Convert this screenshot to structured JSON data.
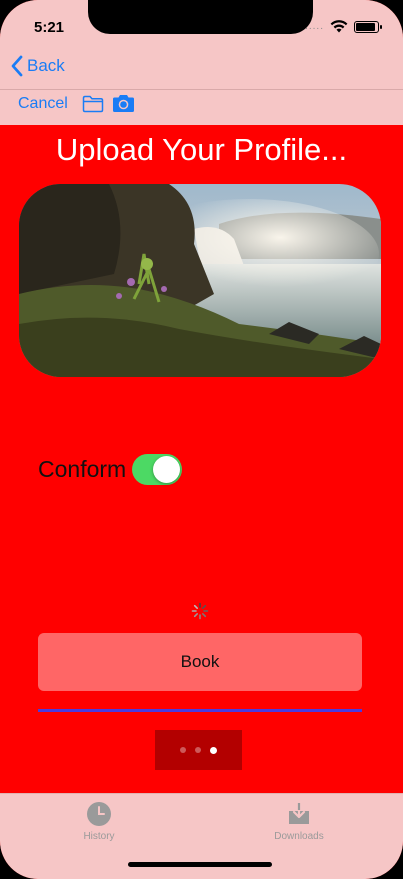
{
  "status_bar": {
    "time": "5:21",
    "signal": "....."
  },
  "nav": {
    "back_label": "Back"
  },
  "toolbar": {
    "cancel_label": "Cancel",
    "icons": [
      "folder-icon",
      "camera-icon"
    ]
  },
  "main": {
    "title": "Upload Your Profile...",
    "photo_description_icon": "waterfall-landscape-image",
    "conform_label": "Conform",
    "conform_toggle_on": true,
    "book_label": "Book",
    "progress": 1.0,
    "page_control": {
      "pages": 3,
      "current": 3
    }
  },
  "tabbar": {
    "items": [
      {
        "label": "History",
        "icon": "clock-icon"
      },
      {
        "label": "Downloads",
        "icon": "download-icon"
      }
    ]
  },
  "colors": {
    "background": "#ff0000",
    "bars": "#f6c6c6",
    "tint": "#1a7cf5",
    "button": "#ff6666",
    "toggle_on": "#4cd964",
    "progress": "#4a3be0",
    "page_control_bg": "#b30000"
  }
}
